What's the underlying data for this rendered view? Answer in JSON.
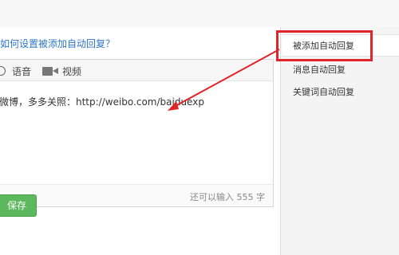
{
  "main": {
    "help_link": "如何设置被添加自动回复？",
    "toolbar": {
      "voice_label": "语音",
      "video_label": "视频"
    },
    "editor_text": "微博，多多关照：http://weibo.com/baiduexp",
    "char_count": "还可以输入 555 字",
    "save_label": "保存"
  },
  "sidebar": {
    "items": [
      {
        "label": "被添加自动回复",
        "active": true
      },
      {
        "label": "消息自动回复",
        "active": false
      },
      {
        "label": "关键词自动回复",
        "active": false
      }
    ]
  },
  "annotation": {
    "highlight_color": "#e0242a",
    "arrow_color": "#e0242a"
  }
}
